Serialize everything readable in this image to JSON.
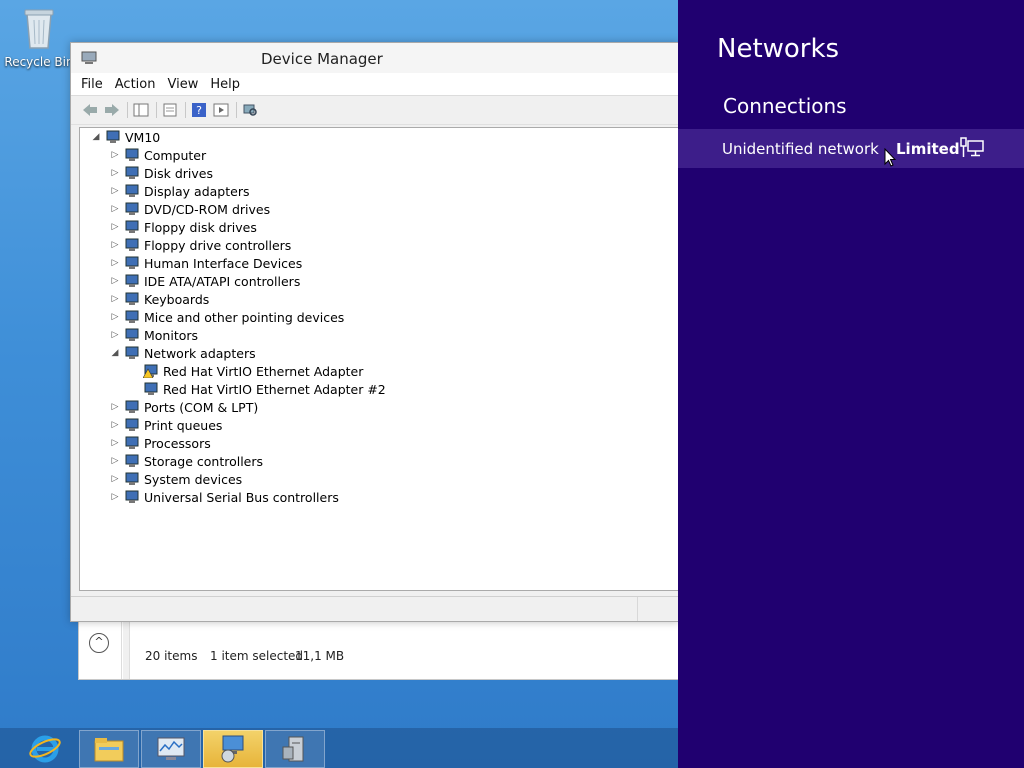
{
  "desktop": {
    "recycle_bin_label": "Recycle Bin"
  },
  "device_manager": {
    "title": "Device Manager",
    "menu": [
      "File",
      "Action",
      "View",
      "Help"
    ],
    "tree": {
      "root": "VM10",
      "items": [
        {
          "label": "Computer",
          "icon": "computer-icon",
          "expanded": false
        },
        {
          "label": "Disk drives",
          "icon": "disk-drive-icon",
          "expanded": false
        },
        {
          "label": "Display adapters",
          "icon": "display-adapter-icon",
          "expanded": false
        },
        {
          "label": "DVD/CD-ROM drives",
          "icon": "dvd-drive-icon",
          "expanded": false
        },
        {
          "label": "Floppy disk drives",
          "icon": "floppy-drive-icon",
          "expanded": false
        },
        {
          "label": "Floppy drive controllers",
          "icon": "floppy-controller-icon",
          "expanded": false
        },
        {
          "label": "Human Interface Devices",
          "icon": "hid-icon",
          "expanded": false
        },
        {
          "label": "IDE ATA/ATAPI controllers",
          "icon": "ide-controller-icon",
          "expanded": false
        },
        {
          "label": "Keyboards",
          "icon": "keyboard-icon",
          "expanded": false
        },
        {
          "label": "Mice and other pointing devices",
          "icon": "mouse-icon",
          "expanded": false
        },
        {
          "label": "Monitors",
          "icon": "monitor-icon",
          "expanded": false
        },
        {
          "label": "Network adapters",
          "icon": "network-adapter-icon",
          "expanded": true,
          "children": [
            {
              "label": "Red Hat VirtIO Ethernet Adapter",
              "icon": "network-adapter-warning-icon"
            },
            {
              "label": "Red Hat VirtIO Ethernet Adapter #2",
              "icon": "network-adapter-icon"
            }
          ]
        },
        {
          "label": "Ports (COM & LPT)",
          "icon": "port-icon",
          "expanded": false
        },
        {
          "label": "Print queues",
          "icon": "printer-icon",
          "expanded": false
        },
        {
          "label": "Processors",
          "icon": "processor-icon",
          "expanded": false
        },
        {
          "label": "Storage controllers",
          "icon": "storage-controller-icon",
          "expanded": false
        },
        {
          "label": "System devices",
          "icon": "system-device-icon",
          "expanded": false
        },
        {
          "label": "Universal Serial Bus controllers",
          "icon": "usb-icon",
          "expanded": false
        }
      ]
    }
  },
  "explorer_status": {
    "items": "20 items",
    "selected": "1 item selected",
    "size": "11,1 MB"
  },
  "taskbar": [
    "internet-explorer-icon",
    "file-explorer-icon",
    "performance-monitor-icon",
    "device-manager-icon",
    "server-manager-icon"
  ],
  "networks_charm": {
    "title": "Networks",
    "section": "Connections",
    "network": {
      "name": "Unidentified network",
      "status": "Limited"
    },
    "colors": {
      "background": "#200070",
      "row_highlight": "#3d1e8a"
    }
  }
}
